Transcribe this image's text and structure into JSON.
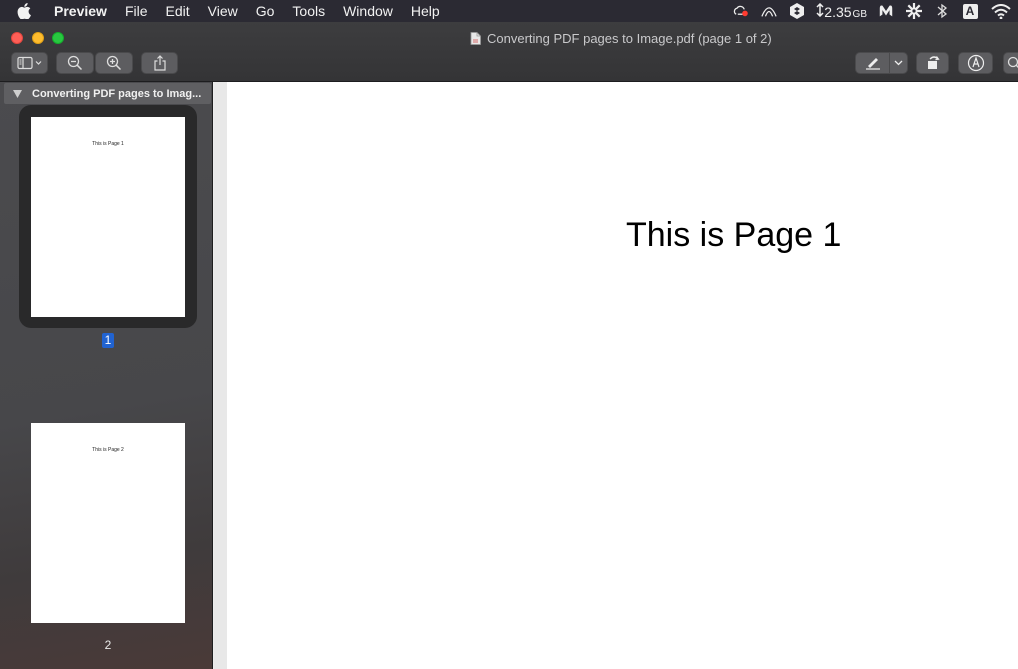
{
  "menubar": {
    "app_name": "Preview",
    "items": [
      "File",
      "Edit",
      "View",
      "Go",
      "Tools",
      "Window",
      "Help"
    ],
    "memory_value": "2.35",
    "memory_unit": "GB",
    "status_icons": [
      "creative-cloud-icon",
      "vpn-arc-icon",
      "shield-dropbox-icon",
      "memory-arrows-icon",
      "malwarebytes-icon",
      "gear-star-icon",
      "bluetooth-icon",
      "input-source-icon",
      "wifi-icon"
    ],
    "input_source": "A"
  },
  "window": {
    "title": "Converting PDF pages to Image.pdf (page 1 of 2)",
    "accent_color": "#2163d1"
  },
  "toolbar": {
    "buttons": [
      "sidebar-toggle-icon",
      "zoom-out-icon",
      "zoom-in-icon",
      "share-icon",
      "highlight-pen-icon",
      "rotate-icon",
      "markup-icon",
      "search-icon"
    ]
  },
  "sidebar": {
    "doc_name": "Converting PDF pages to Imag...",
    "pages": [
      {
        "number": "1",
        "thumb_text": "This is Page 1",
        "selected": true
      },
      {
        "number": "2",
        "thumb_text": "This is Page 2",
        "selected": false
      }
    ]
  },
  "document": {
    "heading": "This is Page 1"
  }
}
